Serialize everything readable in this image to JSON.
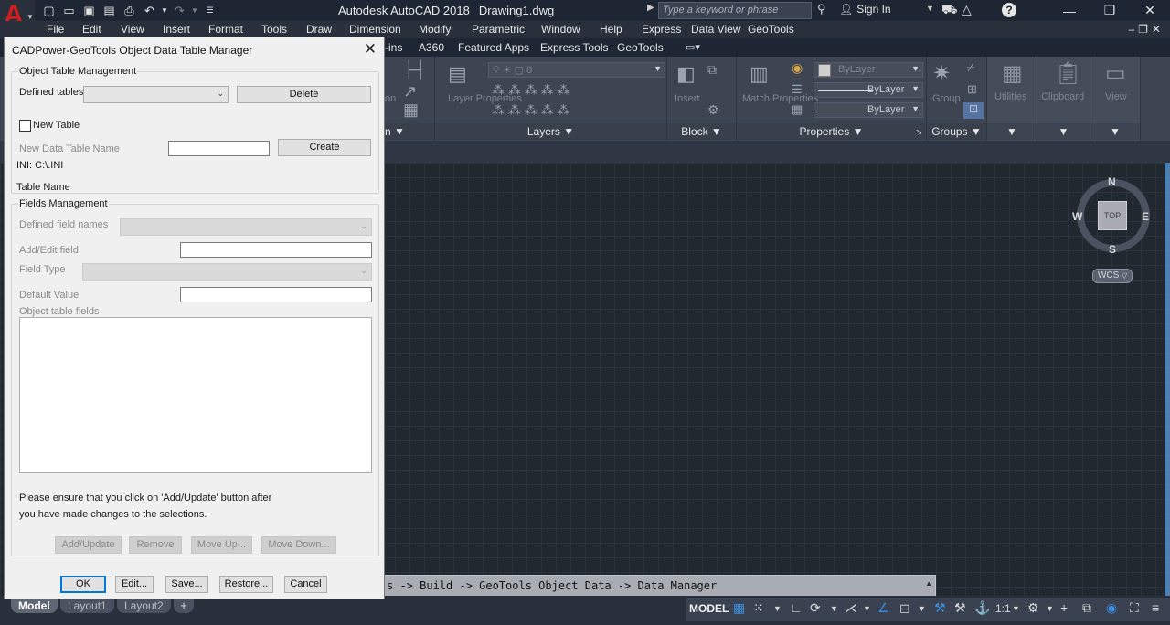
{
  "app": {
    "logo_letter": "A",
    "title": "Autodesk AutoCAD 2018",
    "document": "Drawing1.dwg",
    "search_placeholder": "Type a keyword or phrase",
    "signin": "Sign In"
  },
  "menu": [
    "File",
    "Edit",
    "View",
    "Insert",
    "Format",
    "Tools",
    "Draw",
    "Dimension",
    "Modify",
    "Parametric",
    "Window",
    "Help",
    "Express",
    "Data View",
    "GeoTools"
  ],
  "ribbon_tabs": [
    "-ins",
    "A360",
    "Featured Apps",
    "Express Tools",
    "GeoTools"
  ],
  "ribbon": {
    "panels": {
      "partial": "n",
      "layers": "Layers",
      "block": "Block",
      "properties": "Properties",
      "groups": "Groups"
    },
    "buttons": {
      "layer_properties": "Layer Properties",
      "insert": "Insert",
      "match_properties": "Match Properties",
      "group": "Group",
      "utilities": "Utilities",
      "clipboard": "Clipboard",
      "view": "View",
      "partial_on": "on"
    },
    "layer_combo": "0",
    "bylayer_color": "ByLayer",
    "bylayer_linetype": "ByLayer",
    "bylayer_lineweight": "ByLayer"
  },
  "viewcube": {
    "top": "TOP",
    "n": "N",
    "s": "S",
    "e": "E",
    "w": "W",
    "wcs": "WCS"
  },
  "command_line": "s -> Build -> GeoTools Object Data -> Data Manager",
  "layout_tabs": [
    "Model",
    "Layout1",
    "Layout2"
  ],
  "status": {
    "model": "MODEL",
    "scale": "1:1"
  },
  "dialog": {
    "title": "CADPower-GeoTools Object Data Table Manager",
    "object_table_group": "Object Table Management",
    "defined_tables_label": "Defined tables",
    "defined_tables_value": "",
    "delete_button": "Delete",
    "new_table_label": "New Table",
    "new_table_name_label": "New Data Table Name",
    "new_table_name_value": "",
    "create_button": "Create",
    "ini_label": "INI: C:\\.INI",
    "table_name_label": "Table Name",
    "fields_group": "Fields Management",
    "defined_field_names_label": "Defined field names",
    "add_edit_field_label": "Add/Edit field",
    "field_type_label": "Field Type",
    "default_value_label": "Default Value",
    "object_table_fields_label": "Object table fields",
    "note_line1": "Please ensure that you click on 'Add/Update' button after",
    "note_line2": "you have made changes to the selections.",
    "add_update_button": "Add/Update",
    "remove_button": "Remove",
    "move_up_button": "Move Up...",
    "move_down_button": "Move Down...",
    "ok_button": "OK",
    "edit_button": "Edit...",
    "save_button": "Save...",
    "restore_button": "Restore...",
    "cancel_button": "Cancel"
  },
  "colors": {
    "accent": "#0078d7",
    "app_red": "#d01f1f",
    "canvas": "#212830"
  }
}
